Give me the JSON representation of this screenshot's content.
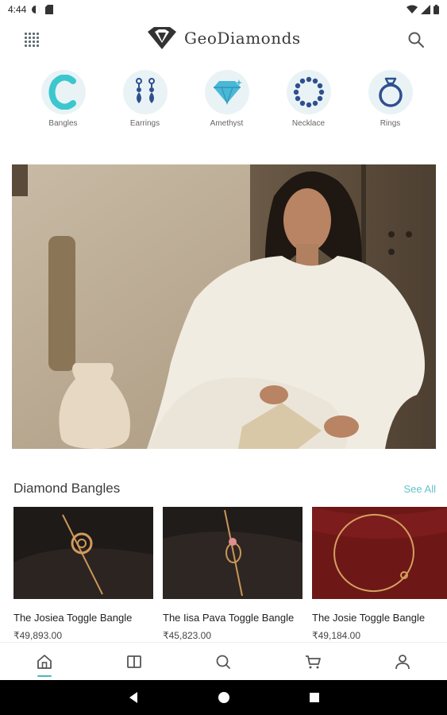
{
  "status_bar": {
    "time": "4:44"
  },
  "header": {
    "brand": "GeoDiamonds"
  },
  "categories": [
    {
      "label": "Bangles",
      "icon": "bangle-c-icon"
    },
    {
      "label": "Earrings",
      "icon": "earrings-icon"
    },
    {
      "label": "Amethyst",
      "icon": "diamond-gem-icon"
    },
    {
      "label": "Necklace",
      "icon": "necklace-icon"
    },
    {
      "label": "Rings",
      "icon": "ring-icon"
    }
  ],
  "section": {
    "title": "Diamond Bangles",
    "see_all": "See All"
  },
  "products": [
    {
      "name": "The Josiea Toggle Bangle",
      "price": "₹49,893.00"
    },
    {
      "name": "The Iisa Pava Toggle Bangle",
      "price": "₹45,823.00"
    },
    {
      "name": "The Josie Toggle Bangle",
      "price": "₹49,184.00"
    }
  ],
  "bottom_nav": [
    "home-icon",
    "catalog-icon",
    "search-icon",
    "cart-icon",
    "profile-icon"
  ],
  "colors": {
    "accent": "#4bb8bd",
    "category_bg": "#e9f3f5",
    "icon_blue": "#2f4f8f"
  }
}
